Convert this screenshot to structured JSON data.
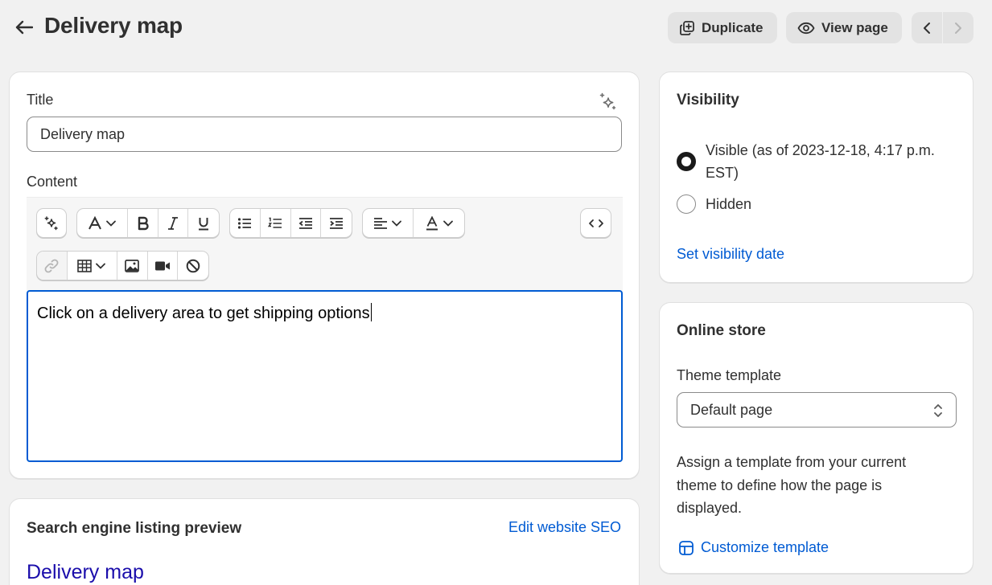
{
  "header": {
    "title": "Delivery map",
    "duplicate_label": "Duplicate",
    "view_page_label": "View page"
  },
  "main": {
    "title_label": "Title",
    "title_value": "Delivery map",
    "content_label": "Content",
    "content_text": "Click on a delivery area to get shipping options"
  },
  "seo": {
    "heading": "Search engine listing preview",
    "edit_link": "Edit website SEO",
    "preview_title": "Delivery map"
  },
  "visibility": {
    "heading": "Visibility",
    "visible_label": "Visible (as of 2023-12-18, 4:17 p.m. EST)",
    "hidden_label": "Hidden",
    "selected": "visible",
    "set_date_link": "Set visibility date"
  },
  "online_store": {
    "heading": "Online store",
    "theme_label": "Theme template",
    "theme_value": "Default page",
    "help_text": "Assign a template from your current theme to define how the page is displayed.",
    "customize_link": "Customize template"
  },
  "colors": {
    "accent": "#005bd3",
    "seo_title": "#1a0dab",
    "background": "#f1f1f1"
  }
}
